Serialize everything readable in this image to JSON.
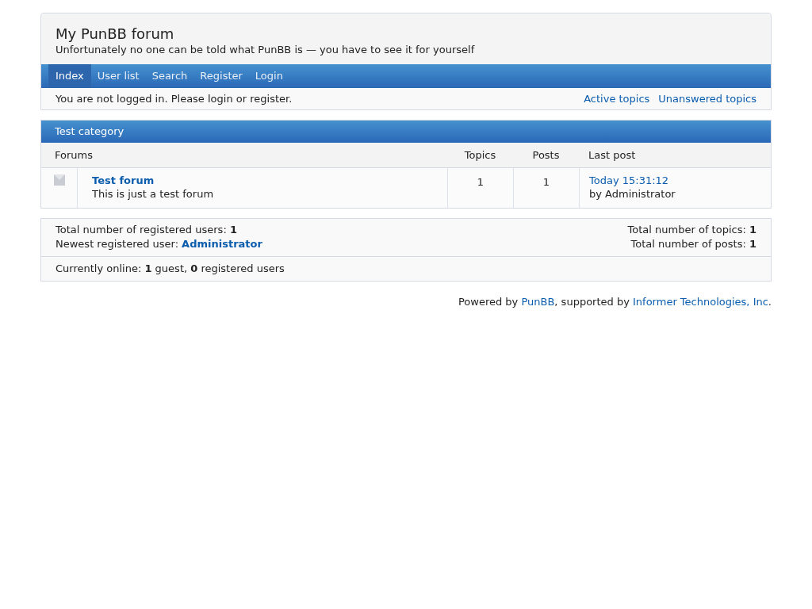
{
  "header": {
    "title": "My PunBB forum",
    "description": "Unfortunately no one can be told what PunBB is — you have to see it for yourself"
  },
  "nav": [
    {
      "label": "Index",
      "selected": true
    },
    {
      "label": "User list",
      "selected": false
    },
    {
      "label": "Search",
      "selected": false
    },
    {
      "label": "Register",
      "selected": false
    },
    {
      "label": "Login",
      "selected": false
    }
  ],
  "status": {
    "message": "You are not logged in. Please login or register.",
    "links": [
      "Active topics",
      "Unanswered topics"
    ]
  },
  "category": {
    "title": "Test category",
    "columns": [
      "Forums",
      "Topics",
      "Posts",
      "Last post"
    ],
    "rows": [
      {
        "name": "Test forum",
        "description": "This is just a test forum",
        "topics": "1",
        "posts": "1",
        "last_post": "Today 15:31:12",
        "last_post_by": "by Administrator",
        "new_posts": false
      }
    ]
  },
  "stats": {
    "left": [
      {
        "kind": "text",
        "text": "Total number of registered users: **1**"
      },
      {
        "kind": "link",
        "label": "Newest registered user:",
        "link": "Administrator"
      }
    ],
    "right": [
      "Total number of topics: **1**",
      "Total number of posts: **1**"
    ],
    "online": "Currently online: **1** guest, **0** registered users"
  },
  "footer": [
    {
      "kind": "text",
      "text": "Powered by "
    },
    {
      "kind": "link",
      "text": "PunBB"
    },
    {
      "kind": "text",
      "text": ", supported by "
    },
    {
      "kind": "link",
      "text": "Informer Technologies, Inc"
    },
    {
      "kind": "text",
      "text": "."
    }
  ]
}
